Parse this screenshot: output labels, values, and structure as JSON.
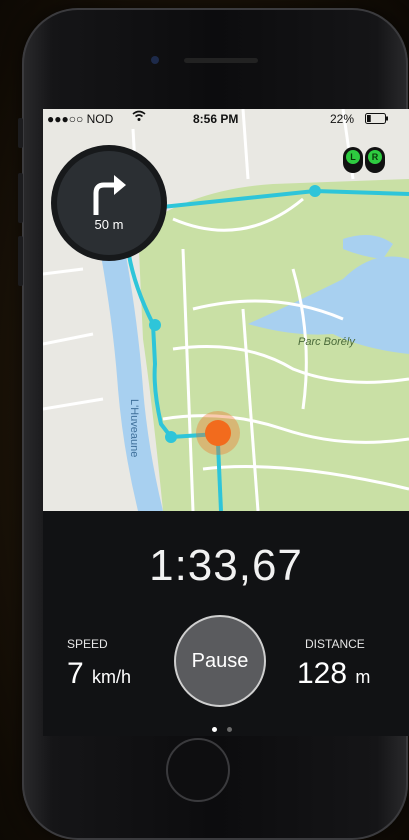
{
  "status_bar": {
    "carrier": "●●●○○ NOD",
    "time": "8:56 PM",
    "battery": "22%",
    "battery_level": 0.22
  },
  "navigation": {
    "turn_icon": "turn-right-icon",
    "distance": "50 m"
  },
  "sensors": [
    {
      "label": "L",
      "color": "#2ecc40"
    },
    {
      "label": "R",
      "color": "#2ecc40"
    }
  ],
  "map": {
    "park_label": "Parc Borély",
    "river_label": "L'Huveaune",
    "route_color": "#2ec5d9",
    "position_color": "#f26b1d"
  },
  "workout": {
    "timer": "1:33,67",
    "speed_label": "SPEED",
    "speed_value": "7",
    "speed_unit": "km/h",
    "distance_label": "DISTANCE",
    "distance_value": "128",
    "distance_unit": "m",
    "pause_label": "Pause"
  },
  "pager": {
    "pages": 2,
    "current": 1
  }
}
